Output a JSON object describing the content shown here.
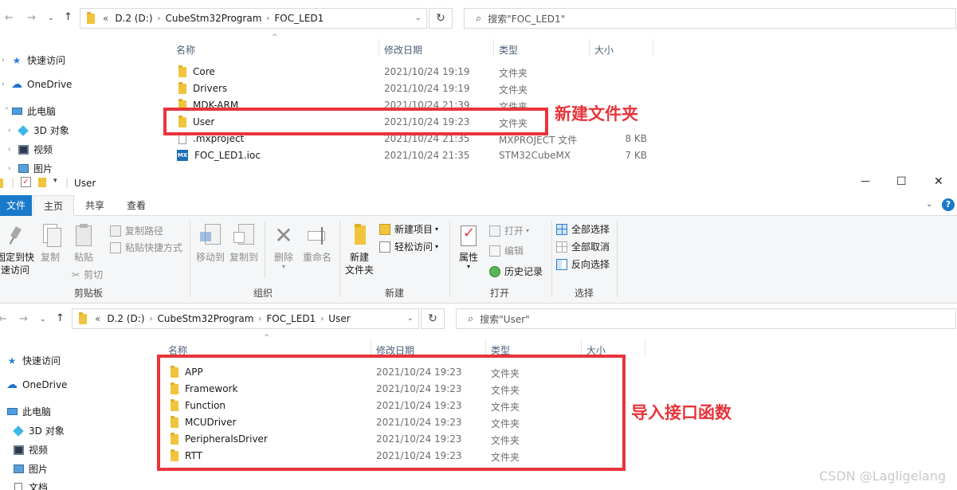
{
  "top": {
    "address": [
      "D.2 (D:)",
      "CubeStm32Program",
      "FOC_LED1"
    ],
    "address_prefix": "«",
    "search_placeholder": "搜索\"FOC_LED1\"",
    "nav": [
      "快速访问",
      "OneDrive",
      "此电脑",
      "3D 对象",
      "视频",
      "图片"
    ],
    "columns": {
      "name": "名称",
      "date": "修改日期",
      "type": "类型",
      "size": "大小"
    },
    "files": [
      {
        "name": "Core",
        "date": "2021/10/24 19:19",
        "type": "文件夹",
        "size": "",
        "icon": "folder-icon"
      },
      {
        "name": "Drivers",
        "date": "2021/10/24 19:19",
        "type": "文件夹",
        "size": "",
        "icon": "folder-icon"
      },
      {
        "name": "MDK-ARM",
        "date": "2021/10/24 21:39",
        "type": "文件夹",
        "size": "",
        "icon": "folder-icon"
      },
      {
        "name": "User",
        "date": "2021/10/24 19:23",
        "type": "文件夹",
        "size": "",
        "icon": "folder-icon"
      },
      {
        "name": ".mxproject",
        "date": "2021/10/24 21:35",
        "type": "MXPROJECT 文件",
        "size": "8 KB",
        "icon": "file-icon"
      },
      {
        "name": "FOC_LED1.ioc",
        "date": "2021/10/24 21:35",
        "type": "STM32CubeMX",
        "size": "7 KB",
        "icon": "mx-icon"
      }
    ],
    "annotation": "新建文件夹"
  },
  "window": {
    "title": "User",
    "min": "—",
    "max": "☐",
    "close": "✕"
  },
  "ribbon": {
    "tabs": [
      "文件",
      "主页",
      "共享",
      "查看"
    ],
    "clipboard": {
      "pin": "固定到快\n速访问",
      "copy": "复制",
      "paste": "粘贴",
      "copy_path": "复制路径",
      "paste_shortcut": "粘贴快捷方式",
      "cut": "剪切",
      "label": "剪贴板"
    },
    "organize": {
      "move_to": "移动到",
      "copy_to": "复制到",
      "delete": "删除",
      "rename": "重命名",
      "label": "组织"
    },
    "new": {
      "new_folder": "新建\n文件夹",
      "new_item": "新建项目",
      "easy_access": "轻松访问",
      "label": "新建"
    },
    "open": {
      "properties": "属性",
      "open": "打开",
      "edit": "编辑",
      "history": "历史记录",
      "label": "打开"
    },
    "select": {
      "select_all": "全部选择",
      "select_none": "全部取消",
      "invert": "反向选择",
      "label": "选择"
    }
  },
  "bottom": {
    "address": [
      "D.2 (D:)",
      "CubeStm32Program",
      "FOC_LED1",
      "User"
    ],
    "address_prefix": "«",
    "search_placeholder": "搜索\"User\"",
    "nav": [
      "快速访问",
      "OneDrive",
      "此电脑",
      "3D 对象",
      "视频",
      "图片",
      "文档"
    ],
    "columns": {
      "name": "名称",
      "date": "修改日期",
      "type": "类型",
      "size": "大小"
    },
    "files": [
      {
        "name": "APP",
        "date": "2021/10/24 19:23",
        "type": "文件夹"
      },
      {
        "name": "Framework",
        "date": "2021/10/24 19:23",
        "type": "文件夹"
      },
      {
        "name": "Function",
        "date": "2021/10/24 19:23",
        "type": "文件夹"
      },
      {
        "name": "MCUDriver",
        "date": "2021/10/24 19:23",
        "type": "文件夹"
      },
      {
        "name": "PeripheralsDriver",
        "date": "2021/10/24 19:23",
        "type": "文件夹"
      },
      {
        "name": "RTT",
        "date": "2021/10/24 19:23",
        "type": "文件夹"
      }
    ],
    "annotation": "导入接口函数"
  },
  "watermark": "CSDN @Lagligelang"
}
